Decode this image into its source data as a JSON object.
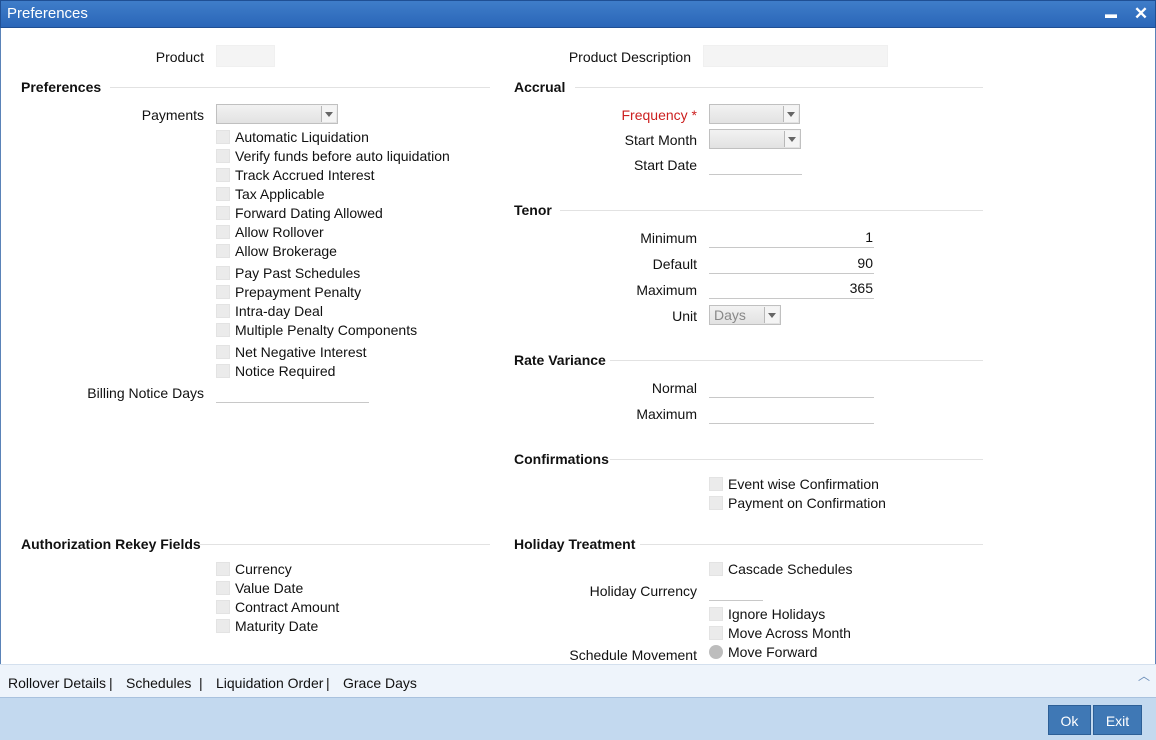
{
  "window": {
    "title": "Preferences",
    "minimize_glyph": "▬",
    "close_glyph": "✕"
  },
  "header": {
    "product_label": "Product",
    "product_value": "",
    "product_description_label": "Product Description",
    "product_description_value": ""
  },
  "preferences": {
    "section": "Preferences",
    "payments_label": "Payments",
    "payments_value": "",
    "checkboxes": [
      "Automatic Liquidation",
      "Verify funds before auto liquidation",
      "Track Accrued Interest",
      "Tax Applicable",
      "Forward Dating Allowed",
      "Allow Rollover",
      "Allow Brokerage",
      "Pay Past Schedules",
      "Prepayment Penalty",
      "Intra-day Deal",
      "Multiple Penalty Components",
      "Net Negative Interest",
      "Notice Required"
    ],
    "billing_notice_days_label": "Billing Notice Days",
    "billing_notice_days_value": ""
  },
  "accrual": {
    "section": "Accrual",
    "frequency_label": "Frequency",
    "frequency_required": "*",
    "frequency_value": "",
    "start_month_label": "Start Month",
    "start_month_value": "",
    "start_date_label": "Start Date",
    "start_date_value": ""
  },
  "tenor": {
    "section": "Tenor",
    "minimum_label": "Minimum",
    "minimum_value": "1",
    "default_label": "Default",
    "default_value": "90",
    "maximum_label": "Maximum",
    "maximum_value": "365",
    "unit_label": "Unit",
    "unit_value": "Days"
  },
  "rate_variance": {
    "section": "Rate Variance",
    "normal_label": "Normal",
    "normal_value": "",
    "maximum_label": "Maximum",
    "maximum_value": ""
  },
  "confirmations": {
    "section": "Confirmations",
    "event_wise": "Event wise Confirmation",
    "payment_on": "Payment on Confirmation"
  },
  "authorization": {
    "section": "Authorization Rekey Fields",
    "checkboxes": [
      "Currency",
      "Value Date",
      "Contract Amount",
      "Maturity Date"
    ]
  },
  "holiday": {
    "section": "Holiday Treatment",
    "cascade": "Cascade Schedules",
    "currency_label": "Holiday Currency",
    "currency_value": "",
    "ignore": "Ignore Holidays",
    "move_across": "Move Across Month",
    "schedule_movement_label": "Schedule Movement",
    "move_forward": "Move Forward"
  },
  "tabs": [
    "Rollover Details",
    "Schedules",
    "Liquidation Order",
    "Grace Days"
  ],
  "tab_separator": "|",
  "buttons": {
    "ok": "Ok",
    "exit": "Exit"
  },
  "colors": {
    "titlebar": "#2a66b8",
    "footer": "#c3d9ef",
    "button": "#3f78b5",
    "required": "#cc1f1f"
  }
}
